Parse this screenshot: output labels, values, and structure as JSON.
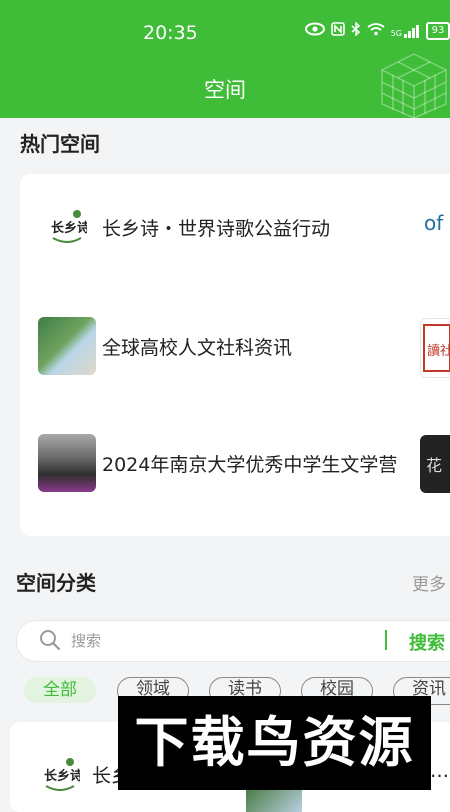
{
  "status_bar": {
    "time": "20:35",
    "network": "5G",
    "battery": "93"
  },
  "header": {
    "title": "空间"
  },
  "hot_section": {
    "title": "热门空间",
    "items": [
      {
        "label": "长乡诗・世界诗歌公益行动",
        "logo_text": "长乡诗"
      },
      {
        "label": "全球高校人文社科资讯"
      },
      {
        "label": "2024年南京大学优秀中学生文学营"
      }
    ],
    "edge_items": [
      {
        "logo_text": "of"
      },
      {
        "logo_text": "讀社"
      },
      {
        "logo_text": "花"
      }
    ]
  },
  "category_section": {
    "title": "空间分类",
    "more_label": "更多"
  },
  "search": {
    "placeholder": "搜索",
    "value": "",
    "button_label": "搜索"
  },
  "chips": [
    {
      "label": "全部",
      "active": true
    },
    {
      "label": "领域",
      "active": false
    },
    {
      "label": "读书",
      "active": false
    },
    {
      "label": "校园",
      "active": false
    },
    {
      "label": "资讯",
      "active": false
    }
  ],
  "bottom_card": {
    "logo_text": "长乡诗",
    "label": "长乡",
    "trailing": "…"
  },
  "watermark": {
    "text": "下载鸟资源"
  },
  "colors": {
    "brand_green": "#3fbd38",
    "chip_active_bg": "#e2f3df",
    "page_bg": "#f3f4f5"
  },
  "icons": {
    "eye": "eye-icon",
    "nfc": "nfc-icon",
    "bluetooth": "bluetooth-icon",
    "wifi": "wifi-icon",
    "signal": "signal-icon",
    "battery": "battery-icon",
    "search": "search-icon",
    "cube": "cube-decoration-icon"
  }
}
